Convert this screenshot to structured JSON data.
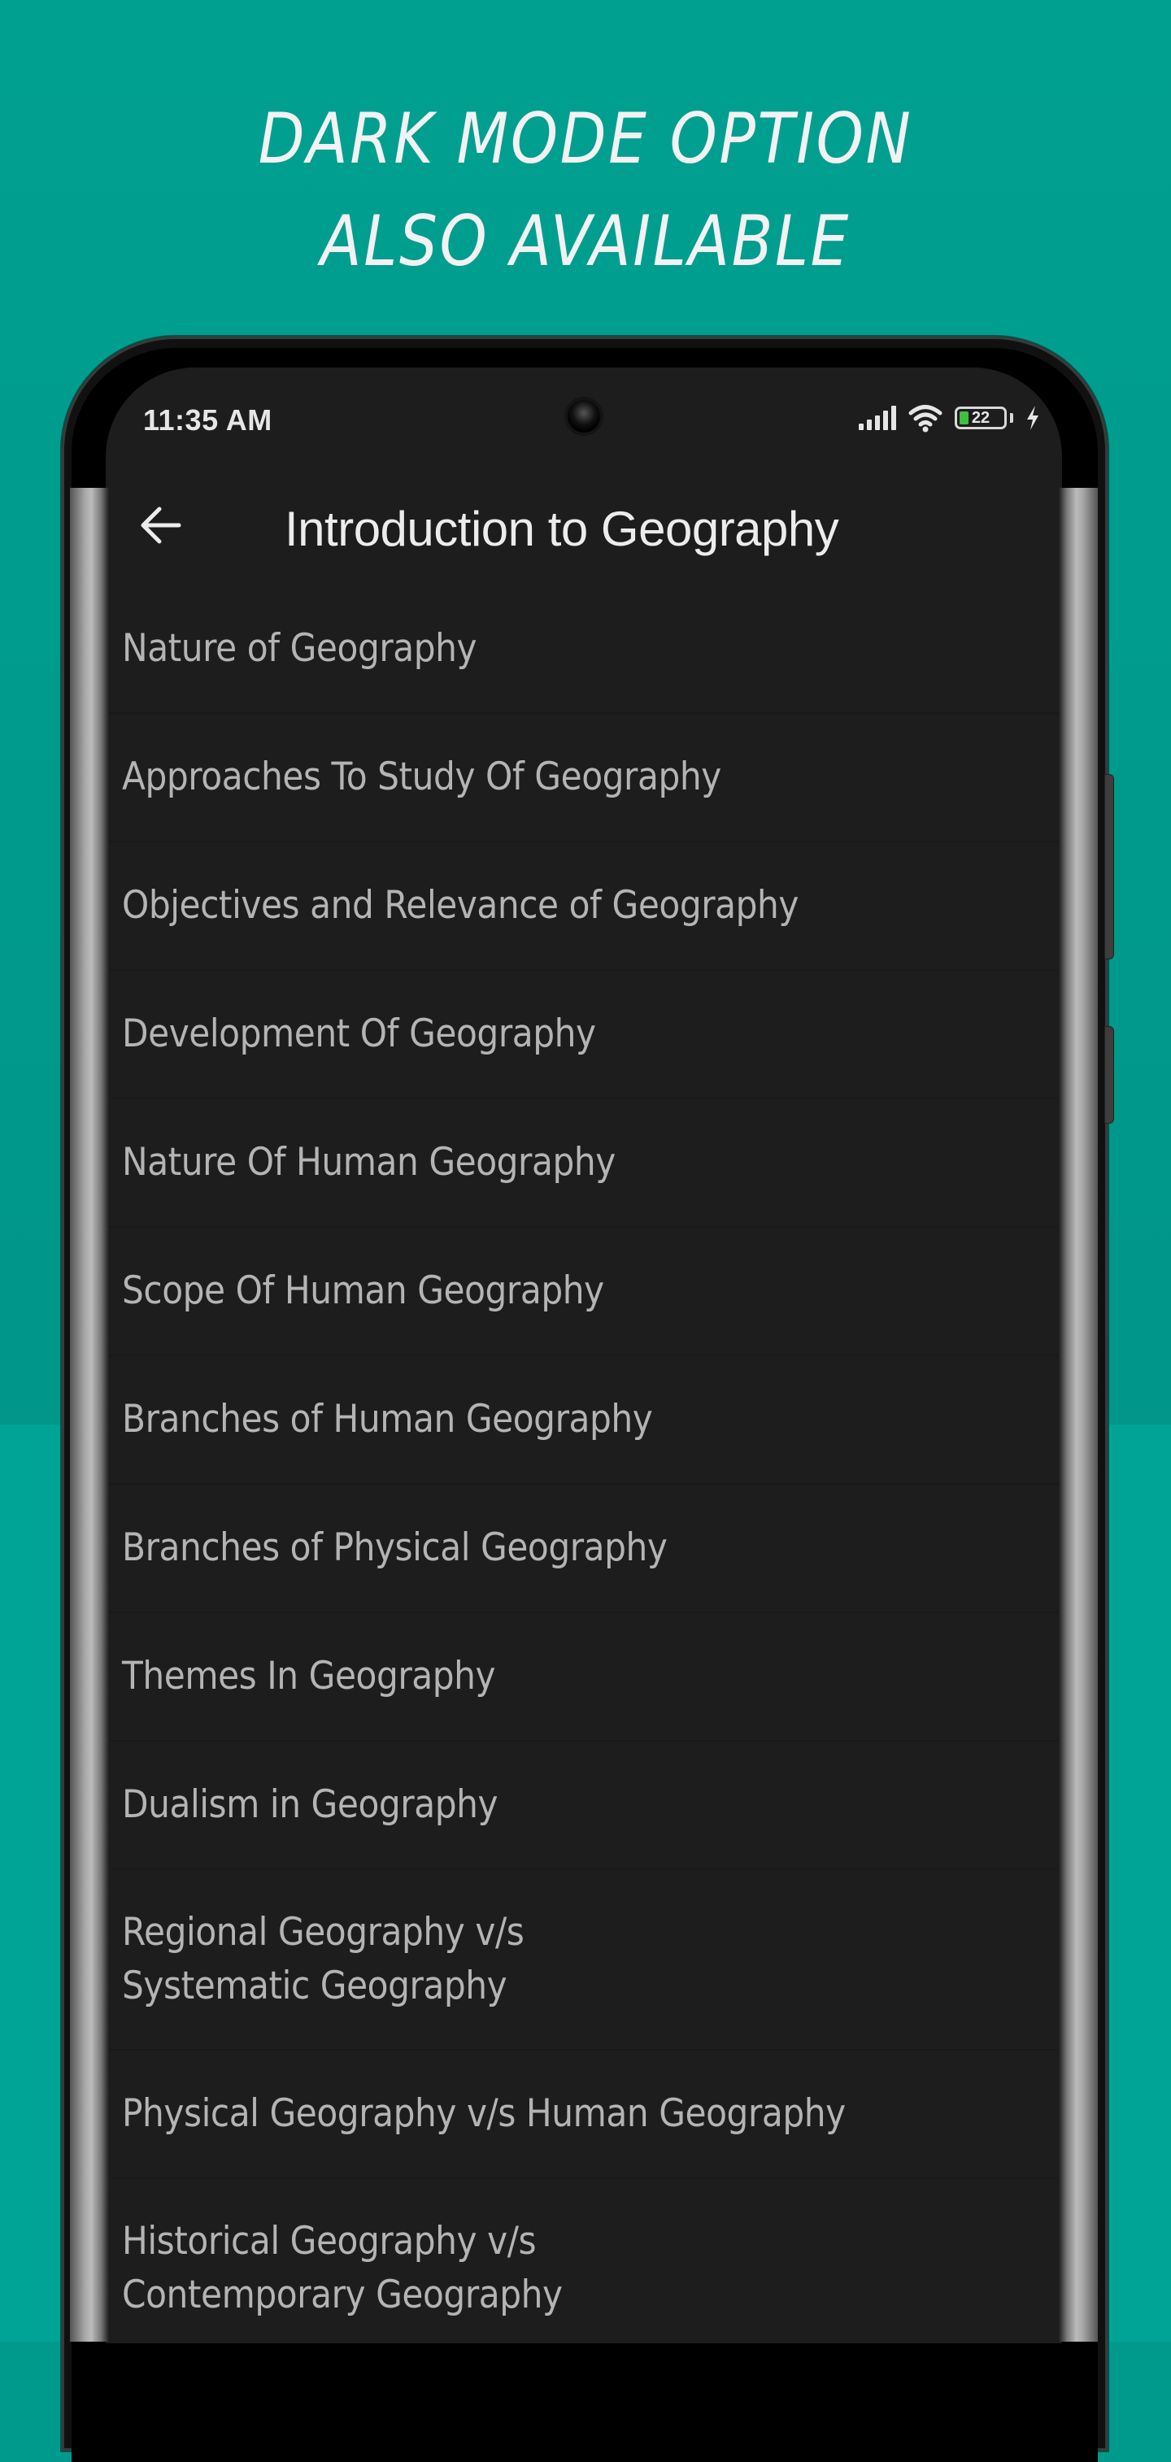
{
  "promo": {
    "headline_line1": "DARK MODE OPTION",
    "headline_line2": "ALSO AVAILABLE"
  },
  "colors": {
    "background_teal": "#009a8d",
    "screen_background": "#1d1d1d",
    "list_text": "#b4b4b4",
    "battery_fill": "#3fbf3f"
  },
  "status_bar": {
    "time": "11:35 AM",
    "battery_level": "22",
    "battery_percent": 22,
    "icons": [
      "signal-icon",
      "wifi-icon",
      "battery-icon",
      "charging-bolt-icon"
    ]
  },
  "toolbar": {
    "back_icon": "arrow-left-icon",
    "title": "Introduction to Geography"
  },
  "topics": [
    {
      "label": "Nature of Geography"
    },
    {
      "label": "Approaches To Study Of Geography"
    },
    {
      "label": "Objectives and Relevance of Geography"
    },
    {
      "label": "Development Of Geography"
    },
    {
      "label": "Nature Of Human Geography"
    },
    {
      "label": "Scope Of Human Geography"
    },
    {
      "label": "Branches of Human Geography"
    },
    {
      "label": "Branches of Physical Geography"
    },
    {
      "label": "Themes In Geography"
    },
    {
      "label": "Dualism in Geography"
    },
    {
      "label": "Regional Geography v/s Systematic Geography"
    },
    {
      "label": "Physical Geography v/s Human Geography"
    },
    {
      "label": "Historical Geography v/s Contemporary Geography"
    }
  ]
}
